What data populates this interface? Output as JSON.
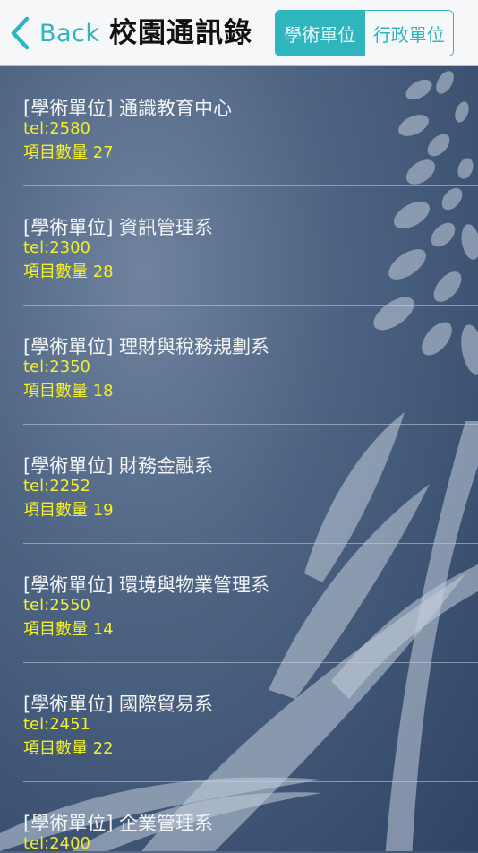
{
  "navbar": {
    "back_label": "Back",
    "title": "校園通訊錄",
    "segments": [
      {
        "label": "學術單位",
        "active": true
      },
      {
        "label": "行政單位",
        "active": false
      }
    ]
  },
  "colors": {
    "accent": "#2fb5be",
    "yellow_text": "#f3ef2a",
    "navbar_bg": "#f6f7f8"
  },
  "icons": {
    "back": "chevron-left-icon"
  },
  "items": [
    {
      "name": "[學術單位] 通識教育中心",
      "tel": "tel:2580",
      "count": "項目數量 27"
    },
    {
      "name": "[學術單位] 資訊管理系",
      "tel": "tel:2300",
      "count": "項目數量 28"
    },
    {
      "name": "[學術單位] 理財與稅務規劃系",
      "tel": "tel:2350",
      "count": "項目數量 18"
    },
    {
      "name": "[學術單位] 財務金融系",
      "tel": "tel:2252",
      "count": "項目數量 19"
    },
    {
      "name": "[學術單位] 環境與物業管理系",
      "tel": "tel:2550",
      "count": "項目數量 14"
    },
    {
      "name": "[學術單位] 國際貿易系",
      "tel": "tel:2451",
      "count": "項目數量 22"
    },
    {
      "name": "[學術單位] 企業管理系",
      "tel": "tel:2400",
      "count": ""
    }
  ]
}
